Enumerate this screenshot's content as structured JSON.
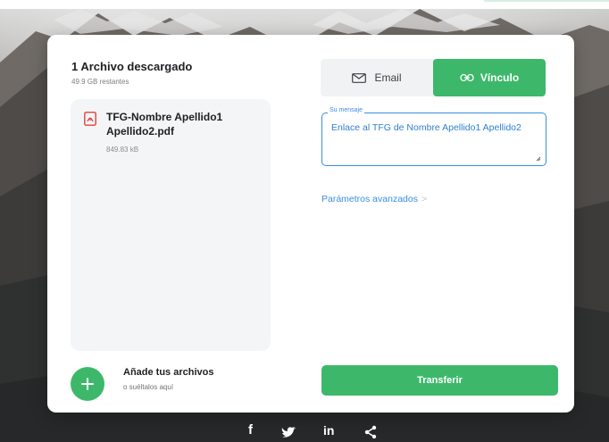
{
  "header": {
    "title": "1 Archivo descargado",
    "subtitle": "49.9 GB restantes"
  },
  "file": {
    "icon": "pdf-file-icon",
    "name": "TFG-Nombre Apellido1 Apellido2.pdf",
    "size": "849.83 kB"
  },
  "add_files": {
    "icon": "plus-icon",
    "title": "Añade tus archivos",
    "subtitle": "o suéltalos aquí"
  },
  "share_tabs": {
    "email_label": "Email",
    "link_label": "Vínculo",
    "active": "link"
  },
  "message": {
    "label": "Su mensaje",
    "value": "Enlace al TFG de Nombre Apellido1 Apellido2"
  },
  "advanced": {
    "label": "Parámetros avanzados",
    "chevron": ">"
  },
  "transfer": {
    "label": "Transferir"
  },
  "social": {
    "facebook": "f",
    "twitter": "twitter-icon",
    "linkedin": "in",
    "share": "share-icon"
  },
  "colors": {
    "accent_green": "#3db86b",
    "accent_blue": "#3a8ee0"
  }
}
